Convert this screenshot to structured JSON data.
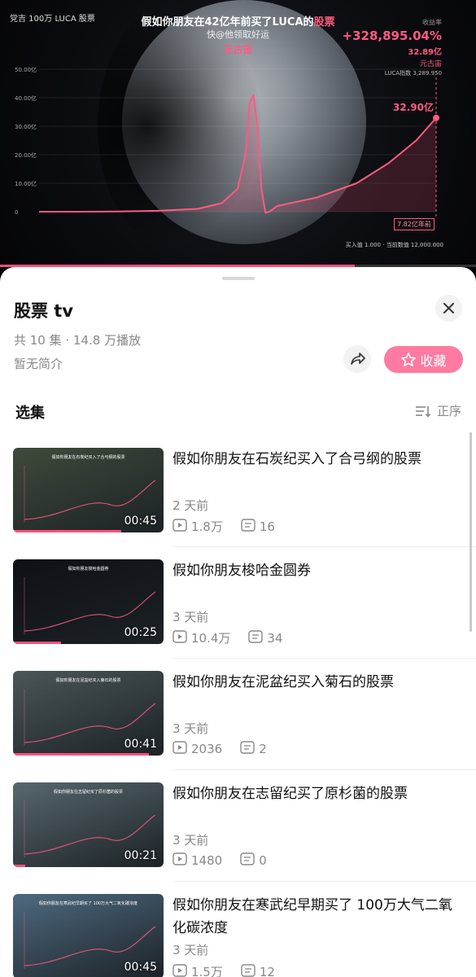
{
  "video": {
    "brand": "党吉 100万 LUCA 股票",
    "title_prefix": "假如你朋友在42亿年前买了LUCA的",
    "title_highlight": "股票",
    "subtitle": "快@他领取好运",
    "era": "元古宙",
    "stats_label": "收益率",
    "return_pct": "+328,895.04%",
    "value": "32.89亿",
    "stats_era": "元古宙",
    "index": "LUCA指数 3,289.950",
    "y_ticks": [
      "50.00亿",
      "40.00亿",
      "30.00亿",
      "20.00亿",
      "10.00亿",
      "0"
    ],
    "end_label": "32.90亿",
    "time_label": "7.82亿年前",
    "bottom_info": "买入值 1.000 · 当前数值 12,000.000",
    "progress": 0.745,
    "accent": "#ff5a82"
  },
  "chart_data": {
    "type": "line",
    "title": "",
    "ylim": [
      0,
      50
    ],
    "yunit": "亿",
    "points": [
      {
        "x": 0,
        "y": 0.0
      },
      {
        "x": 10,
        "y": 0.0
      },
      {
        "x": 20,
        "y": 0.05
      },
      {
        "x": 30,
        "y": 0.3
      },
      {
        "x": 40,
        "y": 1.0
      },
      {
        "x": 46,
        "y": 3.0
      },
      {
        "x": 50,
        "y": 8.0
      },
      {
        "x": 52,
        "y": 20.0
      },
      {
        "x": 53,
        "y": 38.0
      },
      {
        "x": 54,
        "y": 41.0
      },
      {
        "x": 55,
        "y": 30.0
      },
      {
        "x": 56,
        "y": 8.0
      },
      {
        "x": 57,
        "y": -0.3
      },
      {
        "x": 58,
        "y": 0.0
      },
      {
        "x": 60,
        "y": 2.0
      },
      {
        "x": 70,
        "y": 5.0
      },
      {
        "x": 80,
        "y": 10.0
      },
      {
        "x": 88,
        "y": 17.0
      },
      {
        "x": 95,
        "y": 25.0
      },
      {
        "x": 100,
        "y": 32.9
      }
    ]
  },
  "sheet": {
    "title": "股票 tv",
    "meta": "共 10 集 · 14.8 万播放",
    "intro": "暂无简介",
    "fav_label": "收藏",
    "section_title": "选集",
    "sort_label": "正序"
  },
  "episodes": [
    {
      "title": "假如你朋友在石炭纪买入了合弓纲的股票",
      "time": "2 天前",
      "views": "1.8万",
      "comments": "16",
      "duration": "00:45",
      "progress": 0.72,
      "bg": "#3f4a3a"
    },
    {
      "title": "假如你朋友梭哈金圆券",
      "time": "3 天前",
      "views": "10.4万",
      "comments": "34",
      "duration": "00:25",
      "progress": 0.32,
      "bg": "#0e1014"
    },
    {
      "title": "假如你朋友在泥盆纪买入菊石的股票",
      "time": "3 天前",
      "views": "2036",
      "comments": "2",
      "duration": "00:41",
      "progress": 0.9,
      "bg": "#4a5658"
    },
    {
      "title": "假如你朋友在志留纪买了原杉菌的股票",
      "time": "3 天前",
      "views": "1480",
      "comments": "0",
      "duration": "00:21",
      "progress": 0.08,
      "bg": "#57686e"
    },
    {
      "title": "假如你朋友在寒武纪早期买了 100万大气二氧化碳浓度",
      "time": "3 天前",
      "views": "1.5万",
      "comments": "12",
      "duration": "00:45",
      "progress": 0.0,
      "bg": "#4e6a80"
    }
  ]
}
